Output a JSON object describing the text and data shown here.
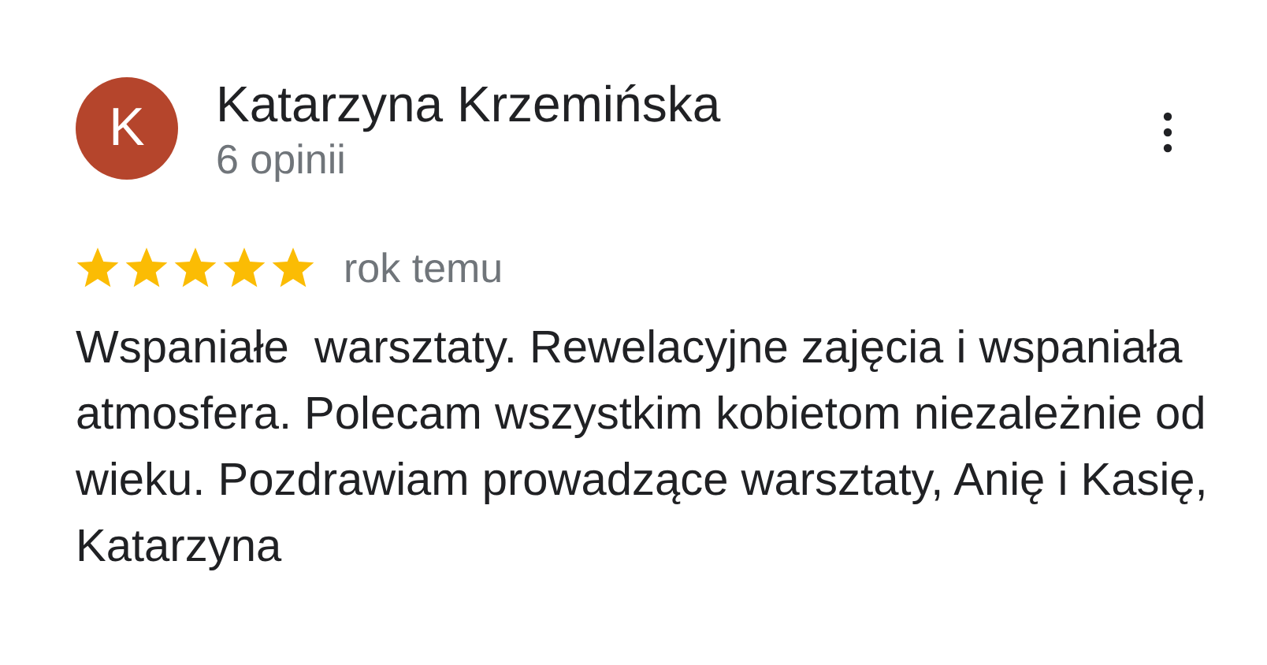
{
  "review": {
    "avatar_letter": "K",
    "author": "Katarzyna Krzemińska",
    "review_count": "6 opinii",
    "stars": 5,
    "time": "rok temu",
    "text": "Wspaniałe  warsztaty. Rewelacyjne zajęcia i wspaniała atmosfera. Polecam wszystkim kobietom niezależnie od wieku. Pozdrawiam prowadzące warsztaty, Anię i Kasię, Katarzyna"
  }
}
